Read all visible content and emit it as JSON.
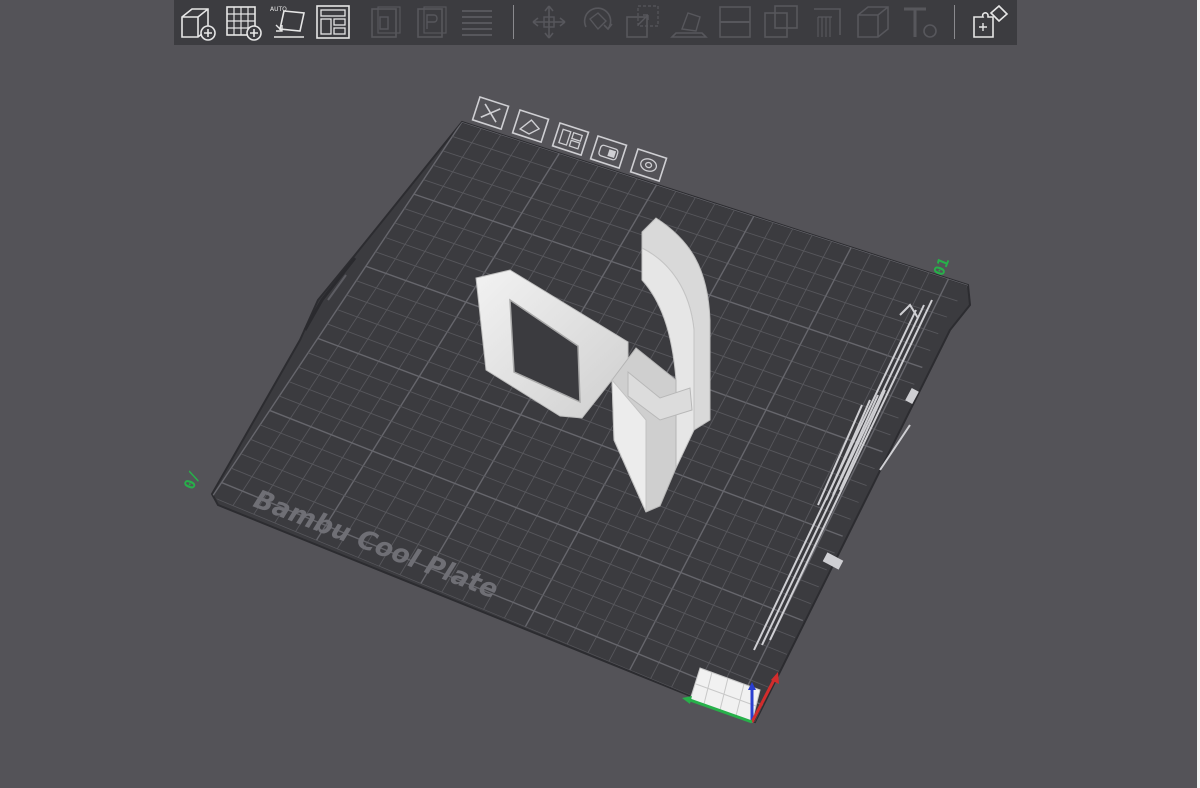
{
  "toolbar": {
    "add_object_icon": "add-cube-icon",
    "add_plate_icon": "add-plate-icon",
    "auto_orient_label": "AUTO",
    "arrange_icon": "arrange-icon"
  },
  "plate": {
    "name": "Bambu Cool Plate",
    "corner_number_top": "01",
    "corner_number_left": "0/"
  },
  "colors": {
    "background": "#545358",
    "toolbar_bg": "#3c3c40",
    "plate_bg": "#3b3b3f",
    "grid_line": "#57575c",
    "model": "#e8e8e8",
    "axis_x": "#d22c2c",
    "axis_y": "#27b04a",
    "axis_z": "#2a3fd0",
    "plate_number": "#27b04a"
  }
}
